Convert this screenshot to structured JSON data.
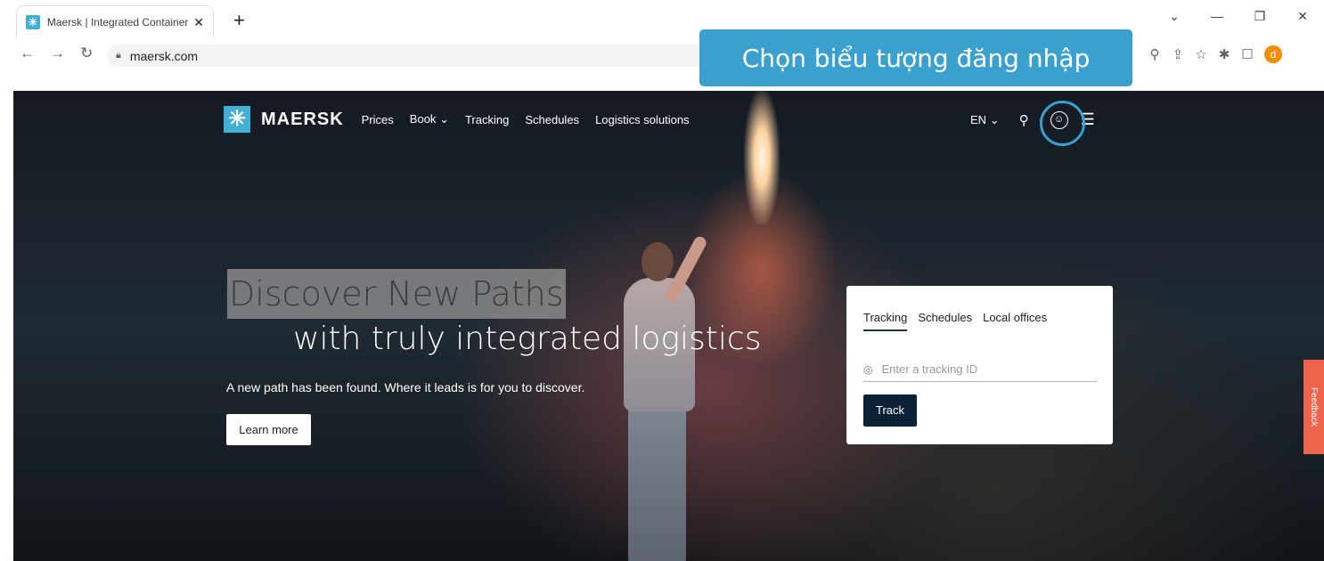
{
  "browser": {
    "tab_title": "Maersk | Integrated Container Lo",
    "tab_favicon": "✳",
    "new_tab_label": "+",
    "url": "maersk.com",
    "profile_initial": "d",
    "icons": [
      "back-icon",
      "forward-icon",
      "reload-icon",
      "lock-icon",
      "zoom-icon",
      "share-icon",
      "star-icon",
      "extensions-icon",
      "sidepanel-icon"
    ]
  },
  "annotation": {
    "text": "Chọn biểu tượng đăng nhập",
    "color": "#3aa0cf"
  },
  "site": {
    "logo_text": "MAERSK",
    "nav": [
      "Prices",
      "Book",
      "Tracking",
      "Schedules",
      "Logistics solutions"
    ],
    "lang": "EN",
    "hero": {
      "title_line1": "Discover New Paths",
      "title_line2": "with truly integrated logistics",
      "subtitle": "A new path has been found. Where it leads is for you to discover.",
      "cta": "Learn more"
    },
    "panel": {
      "tabs": [
        "Tracking",
        "Schedules",
        "Local offices"
      ],
      "active_tab": "Tracking",
      "input_placeholder": "Enter a tracking ID",
      "button": "Track"
    },
    "feedback": "Feedback",
    "brand_color": "#42b0d5"
  }
}
